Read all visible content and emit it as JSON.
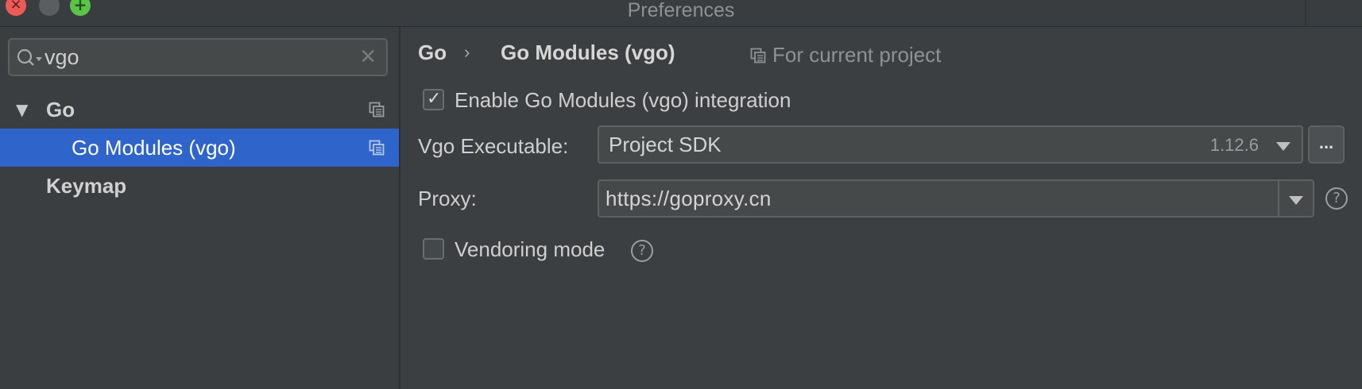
{
  "window": {
    "title": "Preferences"
  },
  "search": {
    "value": "vgo",
    "clear_glyph": "✕"
  },
  "tree": {
    "items": [
      {
        "label": "Go",
        "expanded": true,
        "arrow": "▼"
      },
      {
        "label": "Go Modules (vgo)",
        "selected": true
      },
      {
        "label": "Keymap"
      }
    ]
  },
  "breadcrumb": {
    "parent": "Go",
    "separator": "›",
    "current": "Go Modules (vgo)"
  },
  "scope": {
    "label": "For current project"
  },
  "settings": {
    "enable_label": "Enable Go Modules (vgo) integration",
    "enable_checked": true,
    "checkmark": "✓",
    "vgo_label": "Vgo Executable:",
    "vgo_value": "Project SDK",
    "vgo_version": "1.12.6",
    "browse_label": "...",
    "proxy_label": "Proxy:",
    "proxy_value": "https://goproxy.cn",
    "vendoring_label": "Vendoring mode",
    "vendoring_checked": false,
    "help_glyph": "?"
  },
  "colors": {
    "selection": "#2f65ca",
    "close": "#ec5b57",
    "maximize": "#5cc24a"
  },
  "icons": [
    "close-window-icon",
    "minimize-window-icon",
    "maximize-window-icon",
    "search-icon",
    "clear-icon",
    "expand-arrow-icon",
    "copy-settings-icon",
    "dropdown-arrow-icon",
    "help-icon",
    "checkmark-icon"
  ]
}
